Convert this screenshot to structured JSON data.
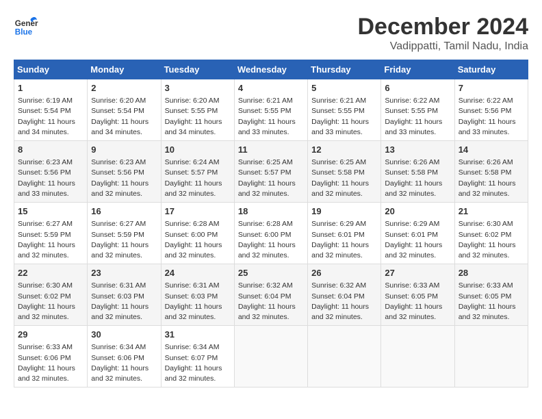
{
  "header": {
    "logo_general": "General",
    "logo_blue": "Blue",
    "month_title": "December 2024",
    "location": "Vadippatti, Tamil Nadu, India"
  },
  "calendar": {
    "days_of_week": [
      "Sunday",
      "Monday",
      "Tuesday",
      "Wednesday",
      "Thursday",
      "Friday",
      "Saturday"
    ],
    "weeks": [
      [
        {
          "day": "",
          "sunrise": "",
          "sunset": "",
          "daylight": ""
        },
        {
          "day": "2",
          "sunrise": "Sunrise: 6:20 AM",
          "sunset": "Sunset: 5:54 PM",
          "daylight": "Daylight: 11 hours and 34 minutes."
        },
        {
          "day": "3",
          "sunrise": "Sunrise: 6:20 AM",
          "sunset": "Sunset: 5:55 PM",
          "daylight": "Daylight: 11 hours and 34 minutes."
        },
        {
          "day": "4",
          "sunrise": "Sunrise: 6:21 AM",
          "sunset": "Sunset: 5:55 PM",
          "daylight": "Daylight: 11 hours and 33 minutes."
        },
        {
          "day": "5",
          "sunrise": "Sunrise: 6:21 AM",
          "sunset": "Sunset: 5:55 PM",
          "daylight": "Daylight: 11 hours and 33 minutes."
        },
        {
          "day": "6",
          "sunrise": "Sunrise: 6:22 AM",
          "sunset": "Sunset: 5:55 PM",
          "daylight": "Daylight: 11 hours and 33 minutes."
        },
        {
          "day": "7",
          "sunrise": "Sunrise: 6:22 AM",
          "sunset": "Sunset: 5:56 PM",
          "daylight": "Daylight: 11 hours and 33 minutes."
        }
      ],
      [
        {
          "day": "1",
          "sunrise": "Sunrise: 6:19 AM",
          "sunset": "Sunset: 5:54 PM",
          "daylight": "Daylight: 11 hours and 34 minutes."
        },
        {
          "day": "8",
          "sunrise": "Sunrise: 6:23 AM",
          "sunset": "Sunset: 5:56 PM",
          "daylight": "Daylight: 11 hours and 33 minutes."
        },
        {
          "day": "9",
          "sunrise": "Sunrise: 6:23 AM",
          "sunset": "Sunset: 5:56 PM",
          "daylight": "Daylight: 11 hours and 32 minutes."
        },
        {
          "day": "10",
          "sunrise": "Sunrise: 6:24 AM",
          "sunset": "Sunset: 5:57 PM",
          "daylight": "Daylight: 11 hours and 32 minutes."
        },
        {
          "day": "11",
          "sunrise": "Sunrise: 6:25 AM",
          "sunset": "Sunset: 5:57 PM",
          "daylight": "Daylight: 11 hours and 32 minutes."
        },
        {
          "day": "12",
          "sunrise": "Sunrise: 6:25 AM",
          "sunset": "Sunset: 5:58 PM",
          "daylight": "Daylight: 11 hours and 32 minutes."
        },
        {
          "day": "13",
          "sunrise": "Sunrise: 6:26 AM",
          "sunset": "Sunset: 5:58 PM",
          "daylight": "Daylight: 11 hours and 32 minutes."
        },
        {
          "day": "14",
          "sunrise": "Sunrise: 6:26 AM",
          "sunset": "Sunset: 5:58 PM",
          "daylight": "Daylight: 11 hours and 32 minutes."
        }
      ],
      [
        {
          "day": "15",
          "sunrise": "Sunrise: 6:27 AM",
          "sunset": "Sunset: 5:59 PM",
          "daylight": "Daylight: 11 hours and 32 minutes."
        },
        {
          "day": "16",
          "sunrise": "Sunrise: 6:27 AM",
          "sunset": "Sunset: 5:59 PM",
          "daylight": "Daylight: 11 hours and 32 minutes."
        },
        {
          "day": "17",
          "sunrise": "Sunrise: 6:28 AM",
          "sunset": "Sunset: 6:00 PM",
          "daylight": "Daylight: 11 hours and 32 minutes."
        },
        {
          "day": "18",
          "sunrise": "Sunrise: 6:28 AM",
          "sunset": "Sunset: 6:00 PM",
          "daylight": "Daylight: 11 hours and 32 minutes."
        },
        {
          "day": "19",
          "sunrise": "Sunrise: 6:29 AM",
          "sunset": "Sunset: 6:01 PM",
          "daylight": "Daylight: 11 hours and 32 minutes."
        },
        {
          "day": "20",
          "sunrise": "Sunrise: 6:29 AM",
          "sunset": "Sunset: 6:01 PM",
          "daylight": "Daylight: 11 hours and 32 minutes."
        },
        {
          "day": "21",
          "sunrise": "Sunrise: 6:30 AM",
          "sunset": "Sunset: 6:02 PM",
          "daylight": "Daylight: 11 hours and 32 minutes."
        }
      ],
      [
        {
          "day": "22",
          "sunrise": "Sunrise: 6:30 AM",
          "sunset": "Sunset: 6:02 PM",
          "daylight": "Daylight: 11 hours and 32 minutes."
        },
        {
          "day": "23",
          "sunrise": "Sunrise: 6:31 AM",
          "sunset": "Sunset: 6:03 PM",
          "daylight": "Daylight: 11 hours and 32 minutes."
        },
        {
          "day": "24",
          "sunrise": "Sunrise: 6:31 AM",
          "sunset": "Sunset: 6:03 PM",
          "daylight": "Daylight: 11 hours and 32 minutes."
        },
        {
          "day": "25",
          "sunrise": "Sunrise: 6:32 AM",
          "sunset": "Sunset: 6:04 PM",
          "daylight": "Daylight: 11 hours and 32 minutes."
        },
        {
          "day": "26",
          "sunrise": "Sunrise: 6:32 AM",
          "sunset": "Sunset: 6:04 PM",
          "daylight": "Daylight: 11 hours and 32 minutes."
        },
        {
          "day": "27",
          "sunrise": "Sunrise: 6:33 AM",
          "sunset": "Sunset: 6:05 PM",
          "daylight": "Daylight: 11 hours and 32 minutes."
        },
        {
          "day": "28",
          "sunrise": "Sunrise: 6:33 AM",
          "sunset": "Sunset: 6:05 PM",
          "daylight": "Daylight: 11 hours and 32 minutes."
        }
      ],
      [
        {
          "day": "29",
          "sunrise": "Sunrise: 6:33 AM",
          "sunset": "Sunset: 6:06 PM",
          "daylight": "Daylight: 11 hours and 32 minutes."
        },
        {
          "day": "30",
          "sunrise": "Sunrise: 6:34 AM",
          "sunset": "Sunset: 6:06 PM",
          "daylight": "Daylight: 11 hours and 32 minutes."
        },
        {
          "day": "31",
          "sunrise": "Sunrise: 6:34 AM",
          "sunset": "Sunset: 6:07 PM",
          "daylight": "Daylight: 11 hours and 32 minutes."
        },
        {
          "day": "",
          "sunrise": "",
          "sunset": "",
          "daylight": ""
        },
        {
          "day": "",
          "sunrise": "",
          "sunset": "",
          "daylight": ""
        },
        {
          "day": "",
          "sunrise": "",
          "sunset": "",
          "daylight": ""
        },
        {
          "day": "",
          "sunrise": "",
          "sunset": "",
          "daylight": ""
        }
      ]
    ]
  }
}
